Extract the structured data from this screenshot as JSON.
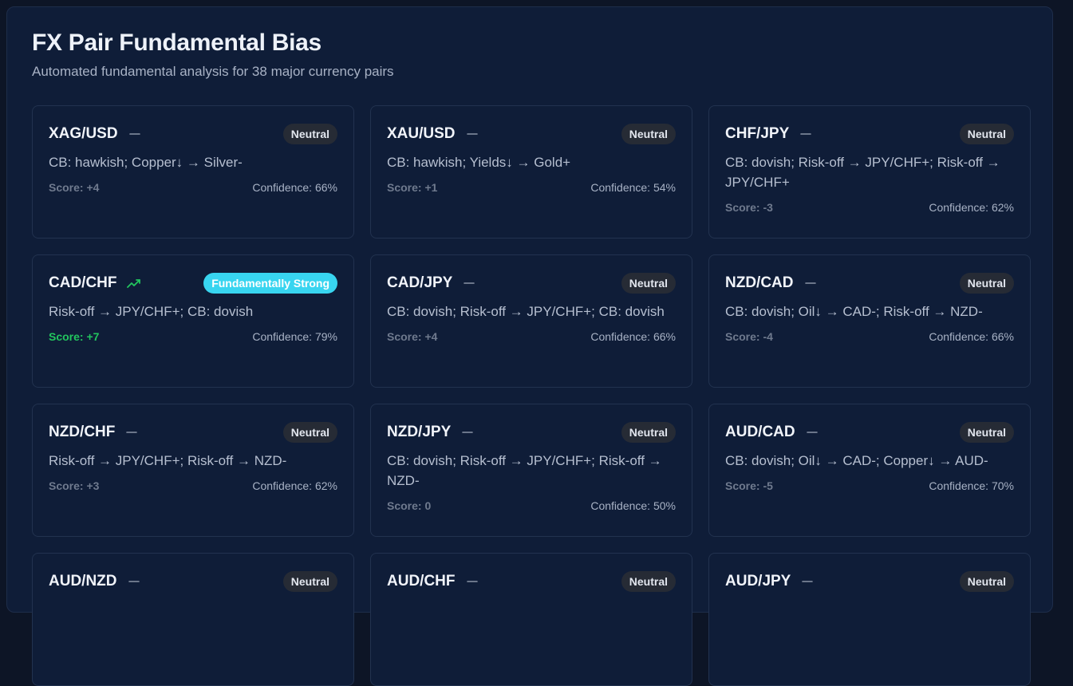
{
  "header": {
    "title": "FX Pair Fundamental Bias",
    "subtitle": "Automated fundamental analysis for 38 major currency pairs"
  },
  "colors": {
    "background": "#0d1526",
    "card": "#0f1d38",
    "neutral_badge": "#262b35",
    "strong_badge": "#38d5f0",
    "positive_score": "#22c55e",
    "muted_score": "#6f7a8e"
  },
  "cards": [
    {
      "pair": "XAG/USD",
      "trend": "flat",
      "badge": "Neutral",
      "desc": "CB: hawkish; Copper↓ → Silver-",
      "score": "Score: +4",
      "confidence": "Confidence: 66%"
    },
    {
      "pair": "XAU/USD",
      "trend": "flat",
      "badge": "Neutral",
      "desc": "CB: hawkish; Yields↓ → Gold+",
      "score": "Score: +1",
      "confidence": "Confidence: 54%"
    },
    {
      "pair": "CHF/JPY",
      "trend": "flat",
      "badge": "Neutral",
      "desc": "CB: dovish; Risk-off → JPY/CHF+; Risk-off → JPY/CHF+",
      "score": "Score: -3",
      "confidence": "Confidence: 62%"
    },
    {
      "pair": "CAD/CHF",
      "trend": "up",
      "badge": "Fundamentally Strong",
      "desc": "Risk-off → JPY/CHF+; CB: dovish",
      "score": "Score: +7",
      "confidence": "Confidence: 79%"
    },
    {
      "pair": "CAD/JPY",
      "trend": "flat",
      "badge": "Neutral",
      "desc": "CB: dovish; Risk-off → JPY/CHF+; CB: dovish",
      "score": "Score: +4",
      "confidence": "Confidence: 66%"
    },
    {
      "pair": "NZD/CAD",
      "trend": "flat",
      "badge": "Neutral",
      "desc": "CB: dovish; Oil↓ → CAD-; Risk-off → NZD-",
      "score": "Score: -4",
      "confidence": "Confidence: 66%"
    },
    {
      "pair": "NZD/CHF",
      "trend": "flat",
      "badge": "Neutral",
      "desc": "Risk-off → JPY/CHF+; Risk-off → NZD-",
      "score": "Score: +3",
      "confidence": "Confidence: 62%"
    },
    {
      "pair": "NZD/JPY",
      "trend": "flat",
      "badge": "Neutral",
      "desc": "CB: dovish; Risk-off → JPY/CHF+; Risk-off → NZD-",
      "score": "Score: 0",
      "confidence": "Confidence: 50%"
    },
    {
      "pair": "AUD/CAD",
      "trend": "flat",
      "badge": "Neutral",
      "desc": "CB: dovish; Oil↓ → CAD-; Copper↓ → AUD-",
      "score": "Score: -5",
      "confidence": "Confidence: 70%"
    },
    {
      "pair": "AUD/NZD",
      "trend": "flat",
      "badge": "Neutral",
      "desc": "",
      "score": "",
      "confidence": ""
    },
    {
      "pair": "AUD/CHF",
      "trend": "flat",
      "badge": "Neutral",
      "desc": "",
      "score": "",
      "confidence": ""
    },
    {
      "pair": "AUD/JPY",
      "trend": "flat",
      "badge": "Neutral",
      "desc": "",
      "score": "",
      "confidence": ""
    }
  ]
}
